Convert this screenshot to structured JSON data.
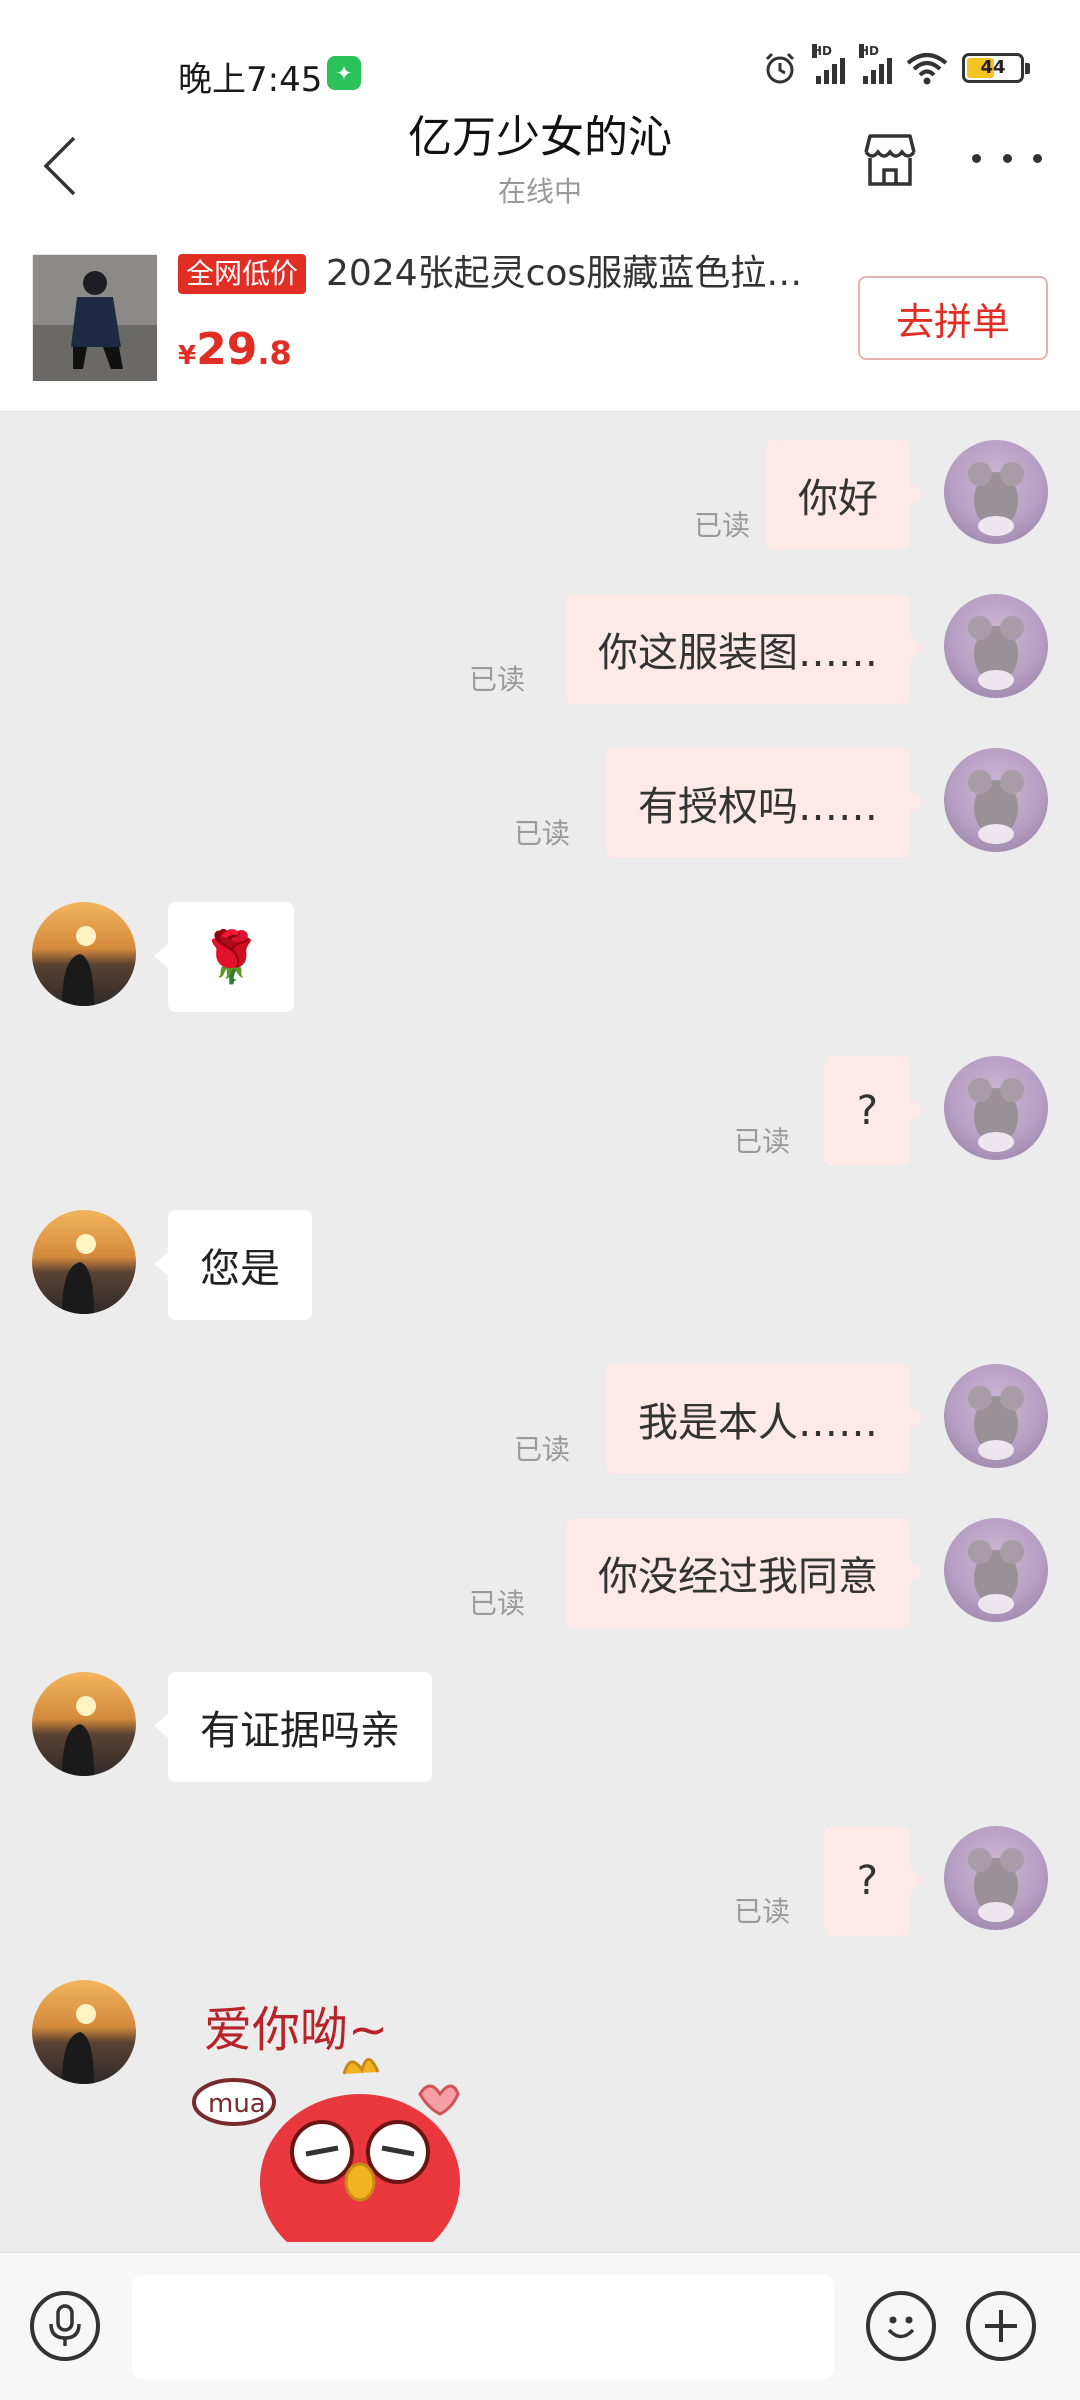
{
  "status_bar": {
    "time": "晚上7:45",
    "battery": "44",
    "signal_label": "HD"
  },
  "header": {
    "title": "亿万少女的沁",
    "subtitle": "在线中"
  },
  "product": {
    "badge": "全网低价",
    "title": "2024张起灵cos服藏蓝色拉…",
    "price_currency": "¥",
    "price_int": "29",
    "price_dec": ".8",
    "action_label": "去拼单"
  },
  "messages": [
    {
      "from": "me",
      "text": "你好",
      "read": "已读"
    },
    {
      "from": "me",
      "text": "你这服装图……",
      "read": "已读"
    },
    {
      "from": "me",
      "text": "有授权吗……",
      "read": "已读"
    },
    {
      "from": "them",
      "text": "🌹"
    },
    {
      "from": "me",
      "text": "?",
      "read": "已读"
    },
    {
      "from": "them",
      "text": "您是"
    },
    {
      "from": "me",
      "text": "我是本人……",
      "read": "已读"
    },
    {
      "from": "me",
      "text": "你没经过我同意",
      "read": "已读"
    },
    {
      "from": "them",
      "text": "有证据吗亲"
    },
    {
      "from": "me",
      "text": "?",
      "read": "已读"
    },
    {
      "from": "them",
      "sticker_text": "爱你呦~",
      "sticker_tag": "mua"
    }
  ],
  "input": {
    "placeholder": ""
  },
  "colors": {
    "accent": "#e02e24",
    "my_bubble": "#fde9e8",
    "their_bubble": "#ffffff",
    "chat_bg": "#ececec"
  }
}
